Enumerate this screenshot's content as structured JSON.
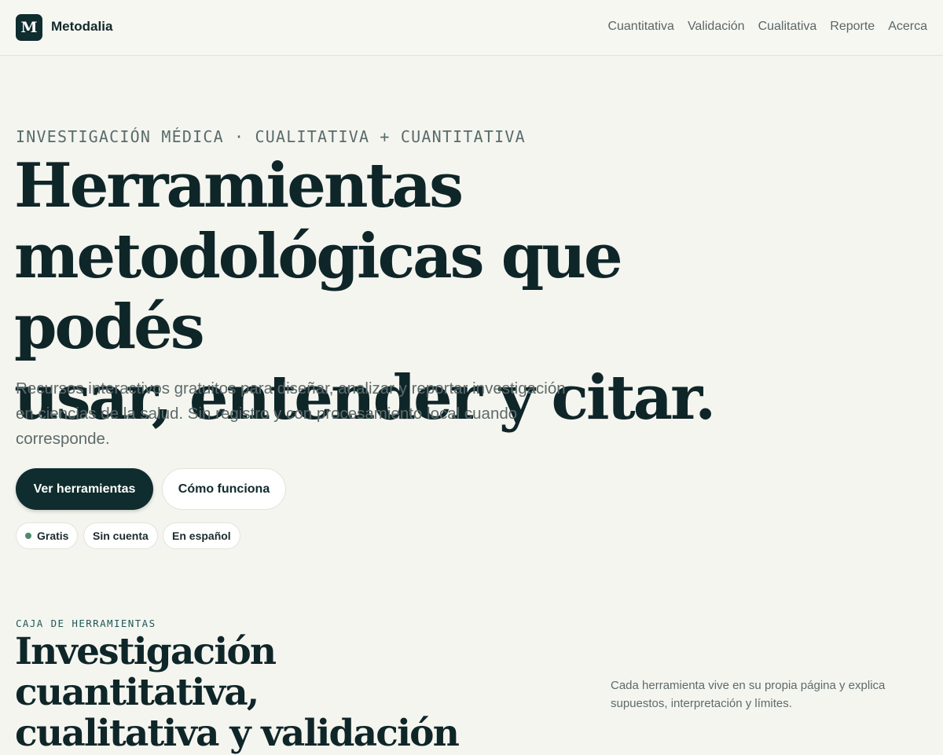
{
  "header": {
    "logo_letter": "M",
    "brand": "Metodalia",
    "nav": [
      "Cuantitativa",
      "Validación",
      "Cualitativa",
      "Reporte",
      "Acerca"
    ]
  },
  "hero": {
    "eyebrow": "INVESTIGACIÓN MÉDICA · CUALITATIVA + CUANTITATIVA",
    "title_lines": [
      "Herramientas",
      "metodológicas que podés",
      "usar, entender y citar."
    ],
    "subtitle": "Recursos interactivos gratuitos para diseñar, analizar y reportar investigación en ciencias de la salud. Sin registro y con procesamiento local cuando corresponde.",
    "primary_button": "Ver herramientas",
    "secondary_button": "Cómo funciona",
    "pills": [
      "Gratis",
      "Sin cuenta",
      "En español"
    ]
  },
  "toolbox": {
    "eyebrow": "CAJA DE HERRAMIENTAS",
    "title_lines": [
      "Investigación cuantitativa,",
      "cualitativa y validación"
    ],
    "note": "Cada herramienta vive en su propia página y explica supuestos, interpretación y límites."
  },
  "colors": {
    "background": "#f5f5ef",
    "primary": "#0f2c2e",
    "muted_text": "#5d6b6b",
    "accent_dot": "#4e8a6d"
  }
}
